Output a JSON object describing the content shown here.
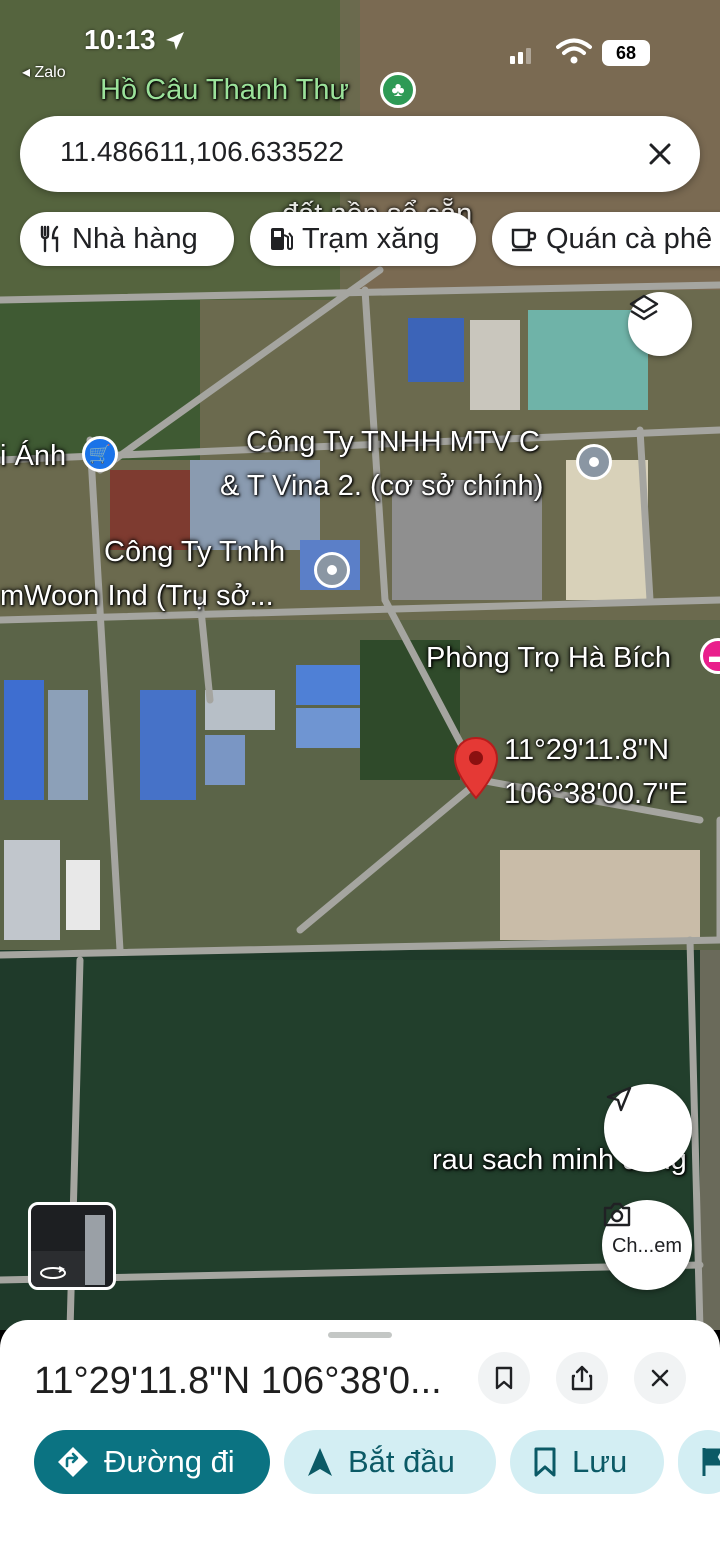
{
  "status_bar": {
    "time": "10:13",
    "back_app": "◂ Zalo",
    "battery": "68"
  },
  "search": {
    "value": "11.486611,106.633522"
  },
  "chips": [
    {
      "label": "Nhà hàng",
      "icon": "fork-knife-icon"
    },
    {
      "label": "Trạm xăng",
      "icon": "gas-station-icon"
    },
    {
      "label": "Quán cà phê",
      "icon": "coffee-cup-icon"
    }
  ],
  "map": {
    "labels": {
      "ho_cau": "Hồ Câu Thanh Thư",
      "dat_nen": "đất nền sổ sẵn",
      "cong_ty_tnhh_mtv_line1": "Công Ty TNHH MTV C",
      "cong_ty_tnhh_mtv_line2": "& T Vina 2. (cơ sở chính)",
      "anh": "i Ánh",
      "cong_ty_namwoon_line1": "Công Ty Tnhh",
      "cong_ty_namwoon_line2": "mWoon Ind (Trụ sở...",
      "phong_tro": "Phòng Trọ Hà Bích",
      "pin_lat": "11°29'11.8\"N",
      "pin_lng": "106°38'00.7\"E",
      "rau_sach": "rau sach minh dung"
    },
    "accent_pin_color": "#e53935",
    "camera_fab_label": "Ch...em"
  },
  "sheet": {
    "title": "11°29'11.8\"N 106°38'0...",
    "actions": [
      {
        "label": "Đường đi",
        "icon": "directions-icon",
        "style": "primary"
      },
      {
        "label": "Bắt đầu",
        "icon": "navigation-arrow-icon",
        "style": "secondary"
      },
      {
        "label": "Lưu",
        "icon": "bookmark-icon",
        "style": "secondary"
      }
    ]
  },
  "colors": {
    "primary_action": "#0b7382",
    "secondary_action": "#d3eef3"
  }
}
